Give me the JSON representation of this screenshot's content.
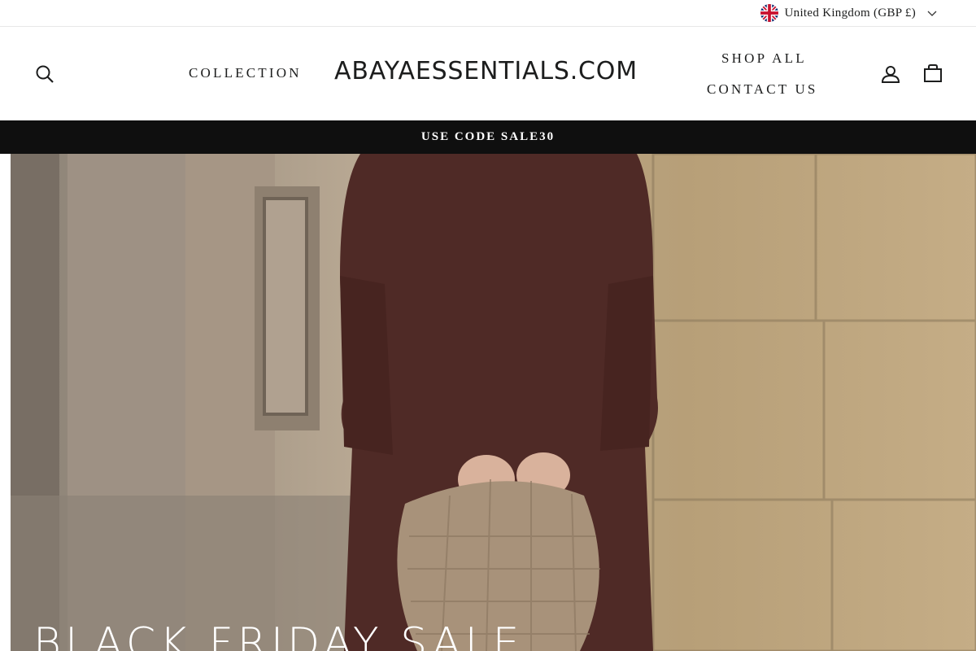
{
  "topbar": {
    "country_label": "United Kingdom (GBP £)"
  },
  "header": {
    "logo": "ABAYAESSENTIALS.COM",
    "nav_left": [
      "COLLECTION"
    ],
    "nav_right": [
      "SHOP ALL",
      "CONTACT US"
    ],
    "icons": [
      "search-icon",
      "user-icon",
      "bag-icon"
    ]
  },
  "promo": {
    "text": "USE CODE SALE30"
  },
  "hero": {
    "title": "BLACK FRIDAY SALE"
  },
  "colors": {
    "promo_bg": "#0f0f0f",
    "text": "#1c1d1d",
    "abaya": "#4f2a26"
  }
}
